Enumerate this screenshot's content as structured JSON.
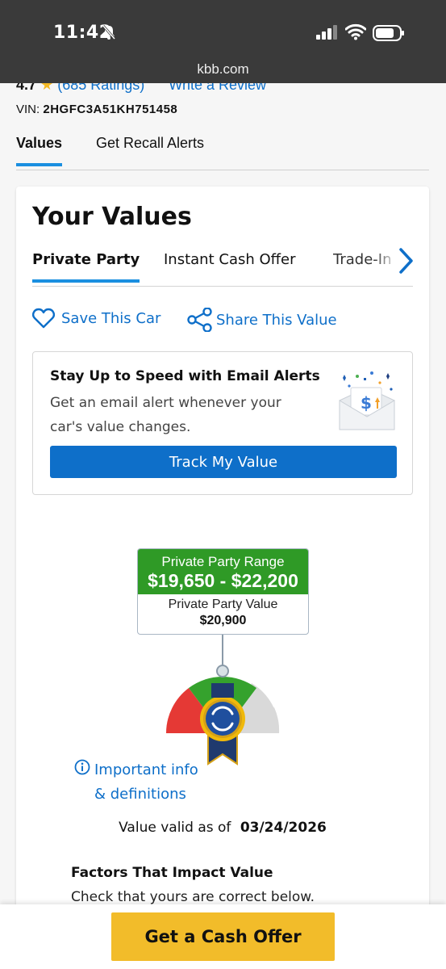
{
  "status_bar": {
    "time": "11:42",
    "url": "kbb.com"
  },
  "header": {
    "rating": "4.7",
    "ratings_count": "(685 Ratings)",
    "write_review": "Write a Review",
    "vin_label": "VIN:",
    "vin_value": "2HGFC3A51KH751458"
  },
  "tabs": [
    {
      "label": "Values",
      "active": true
    },
    {
      "label": "Get Recall Alerts",
      "active": false
    }
  ],
  "card": {
    "title": "Your Values",
    "subtabs": [
      {
        "label": "Private Party",
        "active": true
      },
      {
        "label": "Instant Cash Offer",
        "active": false
      },
      {
        "label": "Trade-In",
        "active": false
      }
    ],
    "save_car": "Save This Car",
    "share_value": "Share This Value",
    "alert": {
      "title": "Stay Up to Speed with Email Alerts",
      "text": "Get an email alert whenever your car's value changes.",
      "button": "Track My Value"
    },
    "range": {
      "label": "Private Party Range",
      "value": "$19,650 - $22,200",
      "pp_label": "Private Party Value",
      "pp_value": "$20,900"
    },
    "info_line1": "Important info",
    "info_line2": "& definitions",
    "valid_label": "Value valid as of",
    "valid_date": "03/24/2026",
    "factors_title": "Factors That Impact Value",
    "factors_sub": "Check that yours are correct below."
  },
  "bottom": {
    "cash_offer": "Get a Cash Offer"
  },
  "colors": {
    "accent_blue": "#0e6fc9",
    "green": "#2f9a26",
    "red": "#e53935",
    "cta_yellow": "#f2bc2a"
  }
}
